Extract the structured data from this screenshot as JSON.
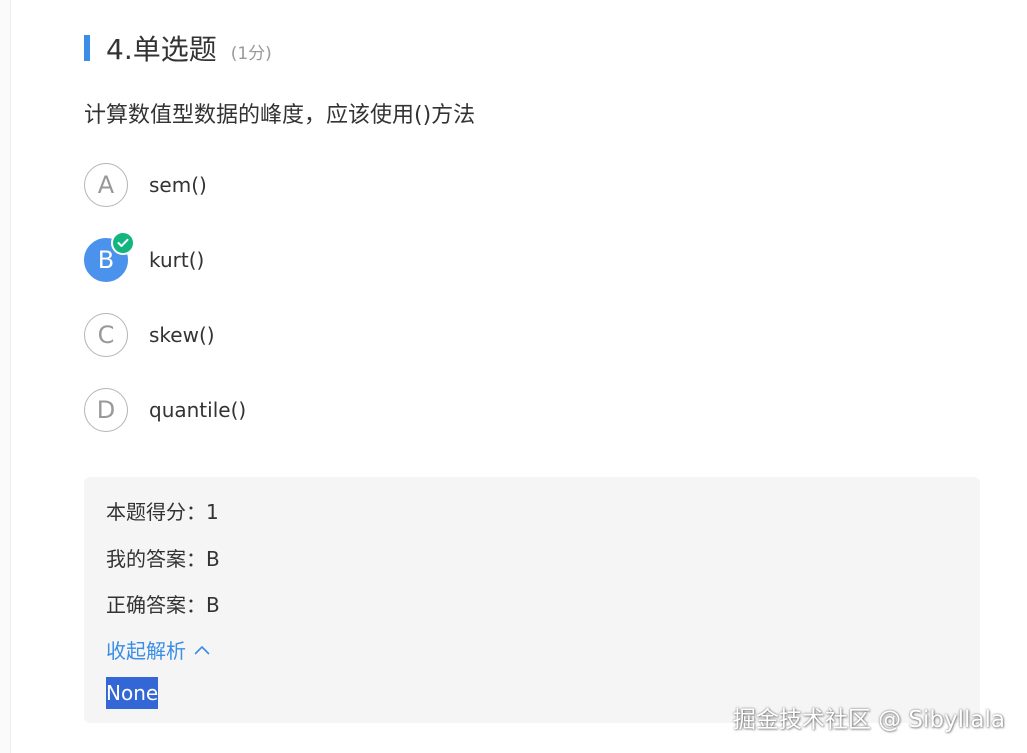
{
  "header": {
    "title": "4.单选题",
    "score": "(1分)"
  },
  "question": {
    "text": "计算数值型数据的峰度，应该使用()方法"
  },
  "options": [
    {
      "letter": "A",
      "text": "sem()",
      "selected": false
    },
    {
      "letter": "B",
      "text": "kurt()",
      "selected": true
    },
    {
      "letter": "C",
      "text": "skew()",
      "selected": false
    },
    {
      "letter": "D",
      "text": "quantile()",
      "selected": false
    }
  ],
  "analysis": {
    "score_line": "本题得分：1",
    "my_answer_line": "我的答案：B",
    "correct_answer_line": "正确答案：B",
    "collapse_label": "收起解析",
    "explanation": "None"
  },
  "watermark": "掘金技术社区 @ Sibyllala",
  "colors": {
    "accent": "#3a8ee6",
    "selected_option": "#4b92ec",
    "correct_badge": "#10b67d",
    "panel_bg": "#f5f5f5",
    "text_selection": "#3367d6"
  },
  "icons": {
    "correct": "check-icon",
    "collapse": "chevron-up-icon"
  }
}
